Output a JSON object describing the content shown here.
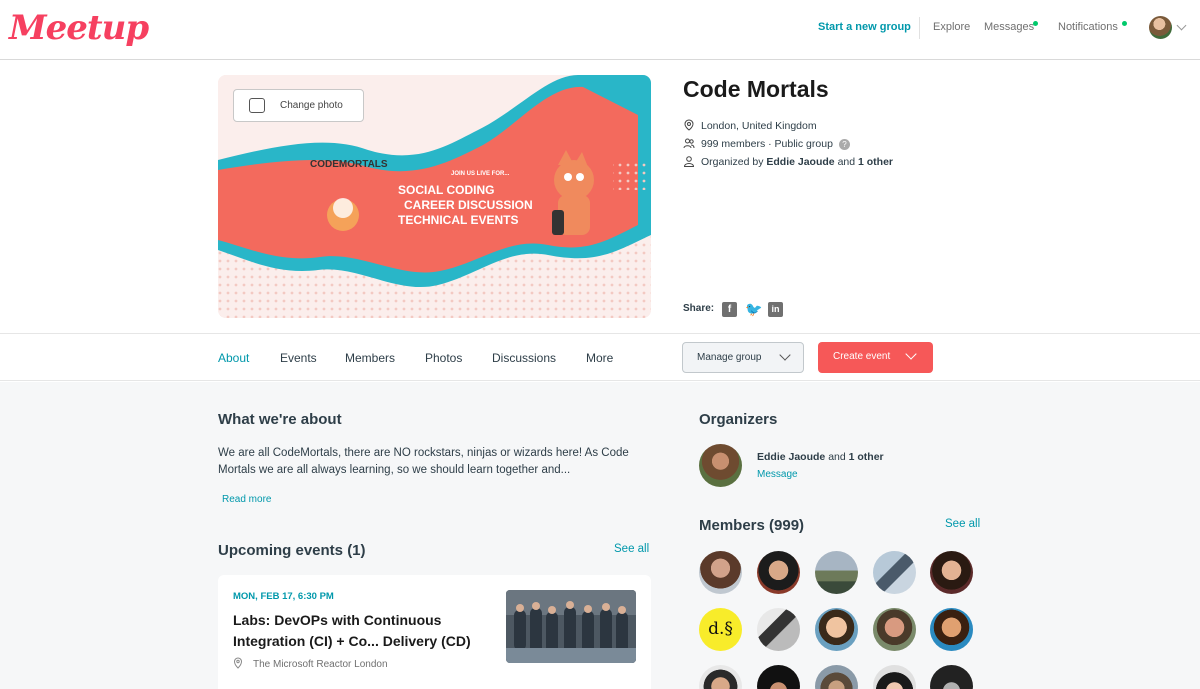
{
  "header": {
    "logo": "Meetup",
    "start_group": "Start a new group",
    "explore": "Explore",
    "messages": "Messages",
    "notifications": "Notifications"
  },
  "hero": {
    "change_photo": "Change photo",
    "banner": {
      "brand": "CODEMORTALS",
      "tagline": "JOIN US LIVE FOR...",
      "items": [
        "SOCIAL CODING",
        "CAREER DISCUSSION",
        "TECHNICAL EVENTS"
      ]
    }
  },
  "group": {
    "name": "Code Mortals",
    "location": "London, United Kingdom",
    "members_text": "999 members",
    "separator": "·",
    "visibility": "Public group",
    "organized_prefix": "Organized by",
    "organizer_name": "Eddie Jaoude",
    "organized_and": "and",
    "organized_other": "1 other",
    "share_label": "Share:"
  },
  "tabs": [
    {
      "label": "About",
      "active": true
    },
    {
      "label": "Events"
    },
    {
      "label": "Members"
    },
    {
      "label": "Photos"
    },
    {
      "label": "Discussions"
    },
    {
      "label": "More"
    }
  ],
  "actions": {
    "manage_group": "Manage group",
    "create_event": "Create event"
  },
  "about": {
    "heading": "What we're about",
    "text": "We are all CodeMortals, there are NO rockstars, ninjas or wizards here! As Code Mortals we are all always learning, so we should learn together and...",
    "read_more": "Read more"
  },
  "upcoming": {
    "heading": "Upcoming events (1)",
    "see_all": "See all",
    "event": {
      "date": "MON, FEB 17, 6:30 PM",
      "title": "Labs: DevOPs with Continuous Integration (CI) + Co... Delivery (CD)",
      "venue": "The Microsoft Reactor London"
    }
  },
  "organizers": {
    "heading": "Organizers",
    "name": "Eddie Jaoude",
    "and": "and",
    "other": "1 other",
    "message": "Message"
  },
  "members_section": {
    "heading": "Members (999)",
    "see_all": "See all",
    "initial_avatar_text": "d.§"
  },
  "colors": {
    "brand": "#f64060",
    "accent": "#0098ab",
    "create_button": "#f65858",
    "notification_dot": "#00c96b"
  }
}
